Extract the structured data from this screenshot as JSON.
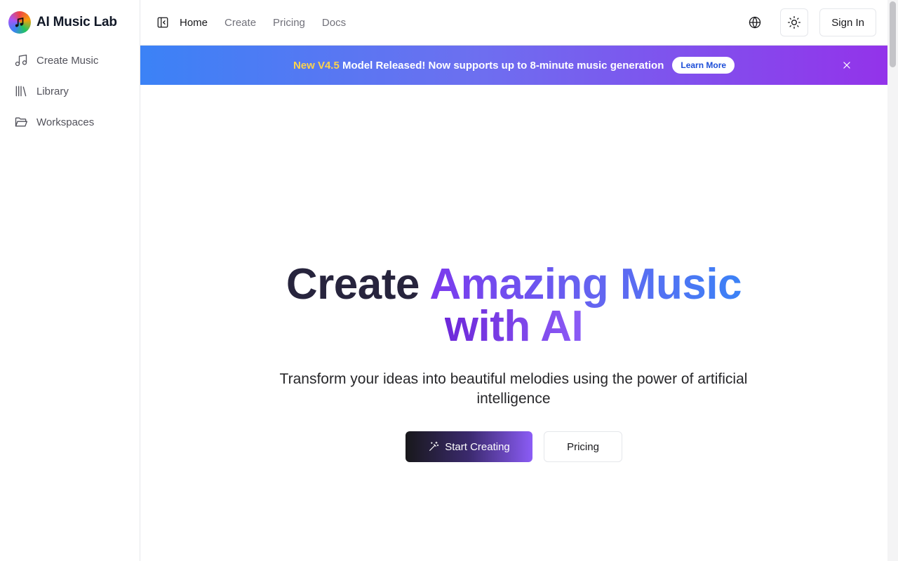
{
  "brand": {
    "name": "AI Music Lab",
    "logo_icon": "music-note-icon"
  },
  "sidebar": {
    "items": [
      {
        "label": "Create Music",
        "icon": "music-icon"
      },
      {
        "label": "Library",
        "icon": "library-icon"
      },
      {
        "label": "Workspaces",
        "icon": "folder-open-icon"
      }
    ]
  },
  "header": {
    "toggle_icon": "sidebar-toggle-icon",
    "links": [
      {
        "label": "Home",
        "active": true
      },
      {
        "label": "Create",
        "active": false
      },
      {
        "label": "Pricing",
        "active": false
      },
      {
        "label": "Docs",
        "active": false
      }
    ],
    "language_icon": "globe-icon",
    "theme_icon": "sun-icon",
    "sign_in_label": "Sign In"
  },
  "announcement": {
    "highlight": "New V4.5",
    "message": " Model Released! Now supports up to 8-minute music generation",
    "button_label": "Learn More",
    "close_icon": "close-icon",
    "colors": {
      "start": "#3b82f6",
      "end": "#9333ea",
      "highlight": "#fcd34d"
    }
  },
  "hero": {
    "title_word1": "Create",
    "title_word2": "Amazing Music",
    "title_line2": "with AI",
    "subtitle": "Transform your ideas into beautiful melodies using the power of artificial intelligence",
    "primary_label": "Start Creating",
    "primary_icon": "magic-wand-icon",
    "secondary_label": "Pricing"
  }
}
